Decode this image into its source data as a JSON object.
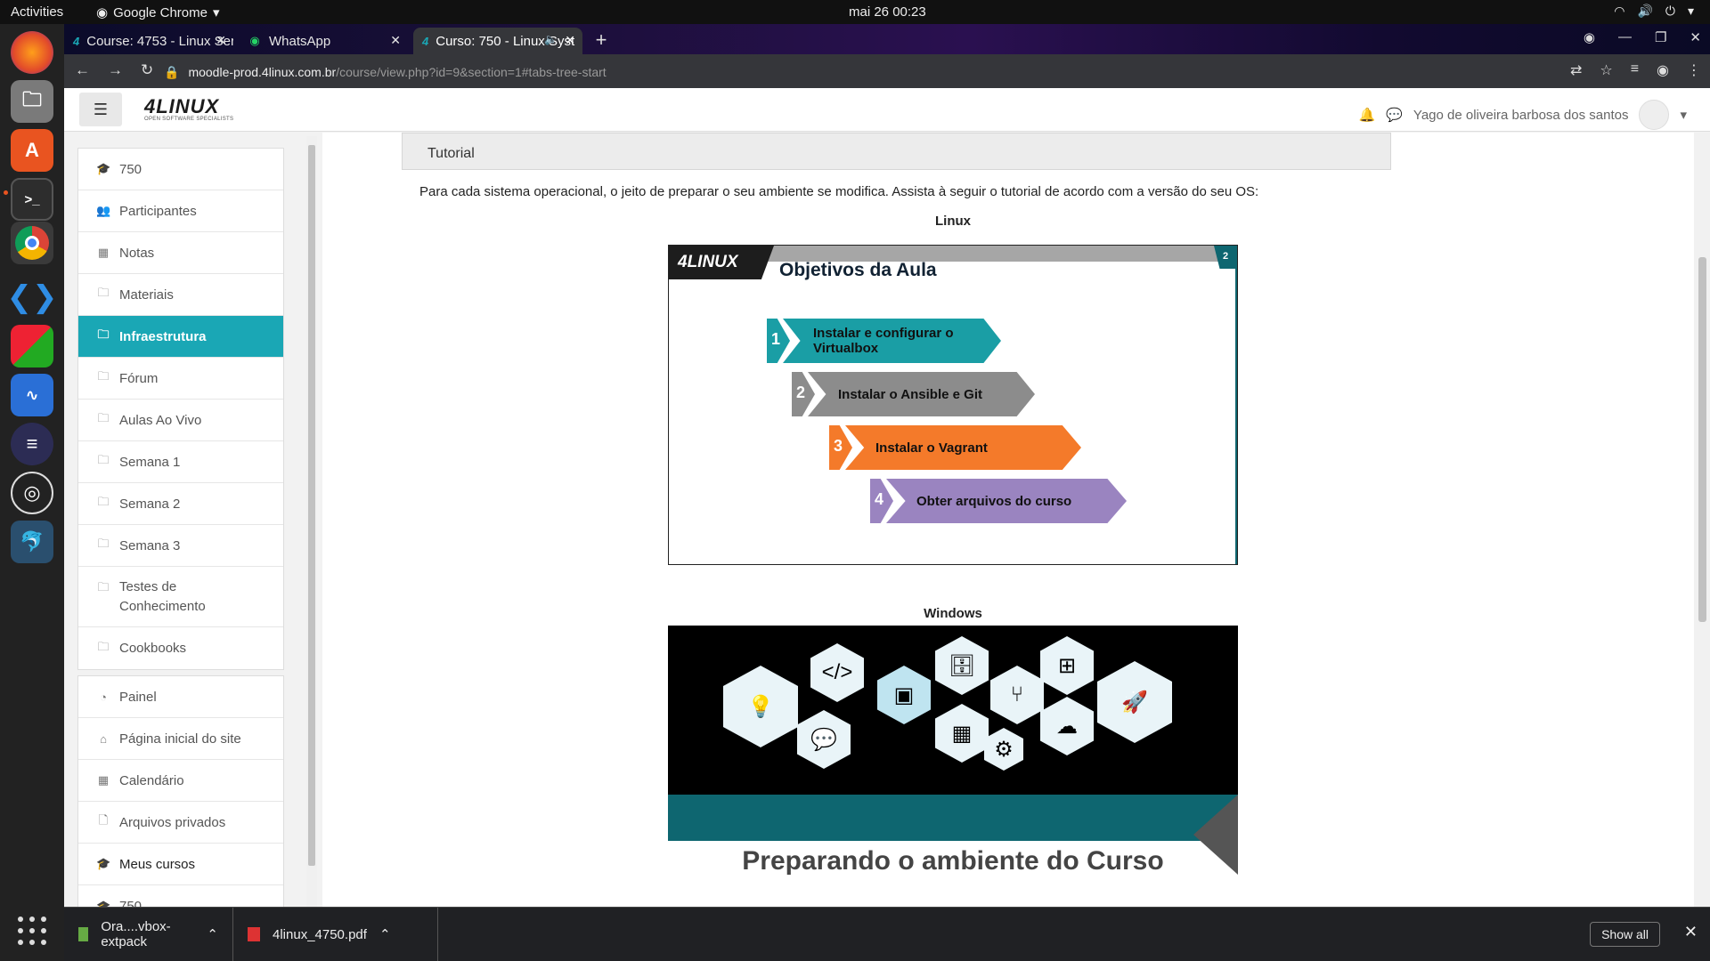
{
  "system": {
    "activities": "Activities",
    "app_name": "Google Chrome",
    "clock": "mai 26  00:23"
  },
  "browser": {
    "tabs": [
      {
        "title": "Course: 4753 - Linux Serve",
        "active": false
      },
      {
        "title": "WhatsApp",
        "active": false
      },
      {
        "title": "Curso: 750 - Linux Syst",
        "active": true
      }
    ],
    "url_host": "moodle-prod.4linux.com.br",
    "url_path": "/course/view.php?id=9&section=1#tabs-tree-start"
  },
  "navbar": {
    "logo_main": "4LINUX",
    "logo_sub": "OPEN SOFTWARE SPECIALISTS",
    "user_name": "Yago de oliveira barbosa dos santos"
  },
  "sidebar": {
    "course_items": [
      {
        "icon": "graduation-cap-icon",
        "glyph": "🎓",
        "label": "750"
      },
      {
        "icon": "users-icon",
        "glyph": "👥",
        "label": "Participantes"
      },
      {
        "icon": "table-icon",
        "glyph": "▦",
        "label": "Notas"
      },
      {
        "icon": "folder-icon",
        "glyph": "🗀",
        "label": "Materiais"
      },
      {
        "icon": "folder-icon",
        "glyph": "🗀",
        "label": "Infraestrutura",
        "active": true
      },
      {
        "icon": "folder-icon",
        "glyph": "🗀",
        "label": "Fórum"
      },
      {
        "icon": "folder-icon",
        "glyph": "🗀",
        "label": "Aulas Ao Vivo"
      },
      {
        "icon": "folder-icon",
        "glyph": "🗀",
        "label": "Semana 1"
      },
      {
        "icon": "folder-icon",
        "glyph": "🗀",
        "label": "Semana 2"
      },
      {
        "icon": "folder-icon",
        "glyph": "🗀",
        "label": "Semana 3"
      },
      {
        "icon": "folder-icon",
        "glyph": "🗀",
        "label": "Testes de Conhecimento"
      },
      {
        "icon": "folder-icon",
        "glyph": "🗀",
        "label": "Cookbooks"
      }
    ],
    "site_items": [
      {
        "icon": "dashboard-icon",
        "glyph": "◔",
        "label": "Painel"
      },
      {
        "icon": "home-icon",
        "glyph": "⌂",
        "label": "Página inicial do site"
      },
      {
        "icon": "calendar-icon",
        "glyph": "▦",
        "label": "Calendário"
      },
      {
        "icon": "file-icon",
        "glyph": "🗋",
        "label": "Arquivos privados"
      },
      {
        "icon": "graduation-cap-icon",
        "glyph": "🎓",
        "label": "Meus cursos"
      },
      {
        "icon": "graduation-cap-icon",
        "glyph": "🎓",
        "label": "750"
      }
    ]
  },
  "content": {
    "section_title": "Tutorial",
    "description": "Para cada sistema operacional, o jeito de preparar o seu ambiente se modifica. Assista à seguir o tutorial de acordo com a versão do seu OS:",
    "linux_label": "Linux",
    "windows_label": "Windows",
    "slide1": {
      "brand": "4LINUX",
      "title": "Objetivos da Aula",
      "page_num": "2",
      "steps": [
        {
          "num": "1",
          "text": "Instalar e configurar o Virtualbox",
          "color": "#1a9ea5"
        },
        {
          "num": "2",
          "text": "Instalar o Ansible e Git",
          "color": "#8c8c8c"
        },
        {
          "num": "3",
          "text": "Instalar o Vagrant",
          "color": "#f47a2a"
        },
        {
          "num": "4",
          "text": "Obter arquivos do curso",
          "color": "#9a84c0"
        }
      ]
    },
    "slide2": {
      "title": "Preparando o ambiente do Curso"
    }
  },
  "downloads": [
    {
      "name": "Ora....vbox-extpack"
    },
    {
      "name": "4linux_4750.pdf"
    }
  ],
  "downloads_show_all": "Show all"
}
